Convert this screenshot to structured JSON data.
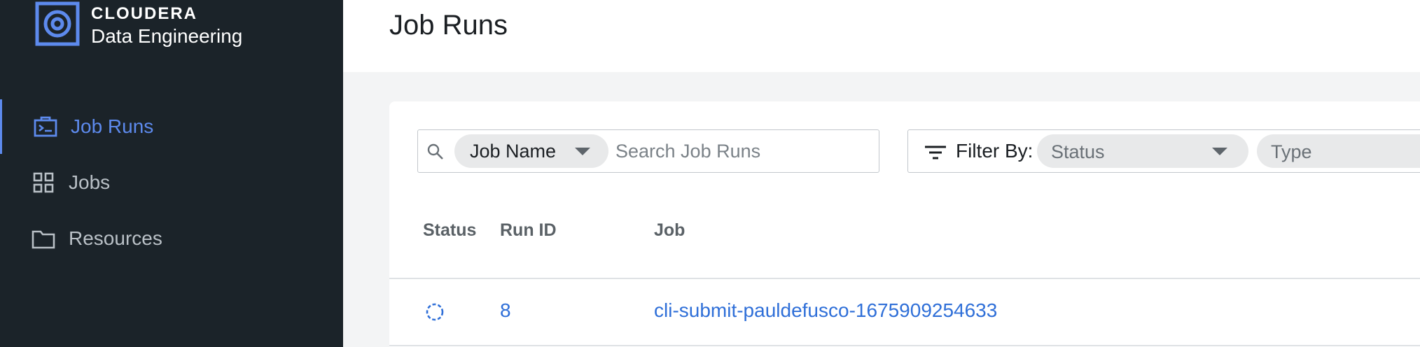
{
  "brand": {
    "name": "CLOUDERA",
    "product": "Data Engineering"
  },
  "sidebar": {
    "items": [
      {
        "label": "Job Runs",
        "icon": "terminal-briefcase-icon",
        "active": true
      },
      {
        "label": "Jobs",
        "icon": "grid-icon",
        "active": false
      },
      {
        "label": "Resources",
        "icon": "folder-icon",
        "active": false
      }
    ]
  },
  "header": {
    "title": "Job Runs"
  },
  "search": {
    "field": "Job Name",
    "placeholder": "Search Job Runs"
  },
  "filter": {
    "label": "Filter By:",
    "status_placeholder": "Status",
    "type_placeholder": "Type"
  },
  "table": {
    "columns": [
      "Status",
      "Run ID",
      "Job"
    ],
    "rows": [
      {
        "status": "running",
        "run_id": "8",
        "job": "cli-submit-pauldefusco-1675909254633"
      }
    ]
  },
  "colors": {
    "sidebar_bg": "#1b2329",
    "accent": "#5d8aed",
    "link": "#2f6fd8"
  }
}
